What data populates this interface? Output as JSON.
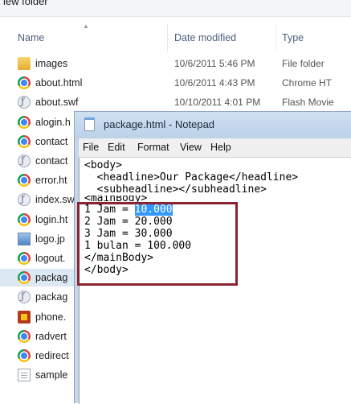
{
  "explorer": {
    "folder_name_partial": "lew folder",
    "columns": {
      "name": "Name",
      "date": "Date modified",
      "type": "Type"
    },
    "files": [
      {
        "name": "images",
        "date": "10/6/2011 5:46 PM",
        "type": "File folder",
        "icon": "folder-icon"
      },
      {
        "name": "about.html",
        "date": "10/6/2011 4:43 PM",
        "type": "Chrome HT",
        "icon": "chrome-icon"
      },
      {
        "name": "about.swf",
        "date": "10/10/2011 4:01 PM",
        "type": "Flash Movie",
        "icon": "flash-icon"
      },
      {
        "name": "alogin.h",
        "date": "",
        "type": "",
        "icon": "chrome-icon"
      },
      {
        "name": "contact",
        "date": "",
        "type": "",
        "icon": "chrome-icon"
      },
      {
        "name": "contact",
        "date": "",
        "type": "",
        "icon": "flash-icon"
      },
      {
        "name": "error.ht",
        "date": "",
        "type": "",
        "icon": "chrome-icon"
      },
      {
        "name": "index.sw",
        "date": "",
        "type": "",
        "icon": "flash-icon"
      },
      {
        "name": "login.ht",
        "date": "",
        "type": "",
        "icon": "chrome-icon"
      },
      {
        "name": "logo.jp",
        "date": "",
        "type": "",
        "icon": "image-icon"
      },
      {
        "name": "logout.",
        "date": "",
        "type": "",
        "icon": "chrome-icon"
      },
      {
        "name": "packag",
        "date": "",
        "type": "",
        "icon": "chrome-icon"
      },
      {
        "name": "packag",
        "date": "",
        "type": "",
        "icon": "flash-icon"
      },
      {
        "name": "phone.",
        "date": "",
        "type": "",
        "icon": "photoshop-icon"
      },
      {
        "name": "radvert",
        "date": "",
        "type": "",
        "icon": "chrome-icon"
      },
      {
        "name": "redirect",
        "date": "",
        "type": "",
        "icon": "chrome-icon"
      },
      {
        "name": "sample",
        "date": "",
        "type": "",
        "icon": "document-icon"
      }
    ],
    "selected_index": 11
  },
  "notepad": {
    "title": "package.html - Notepad",
    "menu": [
      "File",
      "Edit",
      "Format",
      "View",
      "Help"
    ],
    "lines": [
      "<body>",
      "  <headline>Our Package</headline>",
      "  <subheadline></subheadline>",
      "<mainBody>",
      "1 Jam = ",
      "2 Jam = 20.000",
      "3 Jam = 30.000",
      "1 bulan = 100.000",
      "</mainBody>",
      "</body>"
    ],
    "selected_text": "10.000"
  }
}
